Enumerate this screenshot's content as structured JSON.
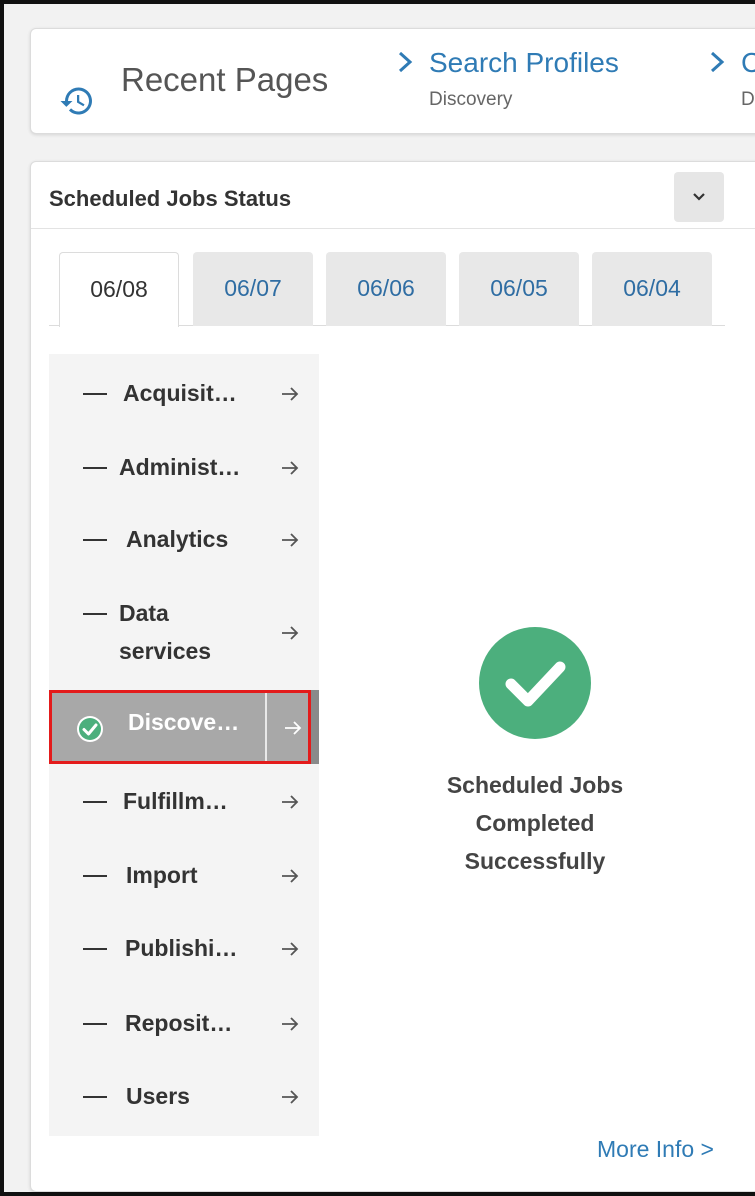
{
  "recent_pages": {
    "title": "Recent Pages",
    "items": [
      {
        "link": "Search Profiles",
        "sub": "Discovery"
      },
      {
        "link": "C",
        "sub": "Di"
      }
    ]
  },
  "widget": {
    "title": "Scheduled Jobs Status",
    "tabs": [
      "06/08",
      "06/07",
      "06/06",
      "06/05",
      "06/04"
    ],
    "active_tab": "06/08",
    "categories": [
      {
        "label": "Acquisit…",
        "status": "dash"
      },
      {
        "label": "Administ…",
        "status": "dash"
      },
      {
        "label": "Analytics",
        "status": "dash"
      },
      {
        "label_lines": [
          "Data",
          "services"
        ],
        "status": "dash"
      },
      {
        "label": "Discove…",
        "status": "success",
        "selected": true
      },
      {
        "label": "Fulfillm…",
        "status": "dash"
      },
      {
        "label": "Import",
        "status": "dash"
      },
      {
        "label": "Publishi…",
        "status": "dash"
      },
      {
        "label": "Reposit…",
        "status": "dash"
      },
      {
        "label": "Users",
        "status": "dash"
      }
    ],
    "status_lines": [
      "Scheduled Jobs",
      "Completed",
      "Successfully"
    ],
    "more_info": "More Info >"
  },
  "colors": {
    "link": "#2f7bb5",
    "success": "#4caf7d",
    "selected_bg": "#a8a8a8",
    "highlight_border": "#e31b1b"
  },
  "icons": {
    "history": "history-icon",
    "chevron": "chevron-right-icon",
    "collapse": "chevron-down-icon",
    "arrow": "arrow-right-icon",
    "check": "check-circle-icon"
  }
}
